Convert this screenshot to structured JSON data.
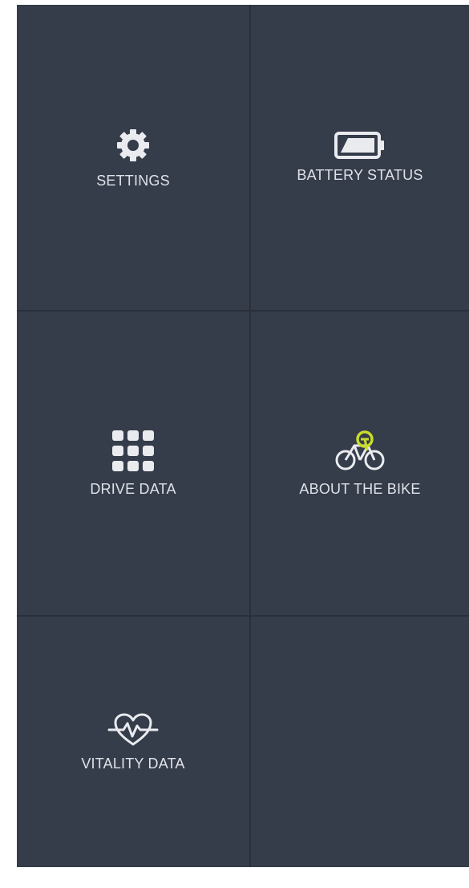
{
  "menu": {
    "tiles": [
      {
        "label": "SETTINGS",
        "icon": "gear-icon"
      },
      {
        "label": "BATTERY STATUS",
        "icon": "battery-icon"
      },
      {
        "label": "DRIVE DATA",
        "icon": "grid-icon"
      },
      {
        "label": "ABOUT THE BIKE",
        "icon": "bike-icon"
      },
      {
        "label": "VITALITY DATA",
        "icon": "heart-pulse-icon"
      }
    ]
  },
  "colors": {
    "background": "#353c4a",
    "divider": "#2a2f3a",
    "label": "#dfe2e8",
    "icon": "#e9ebef",
    "accent": "#c8dc2a"
  }
}
